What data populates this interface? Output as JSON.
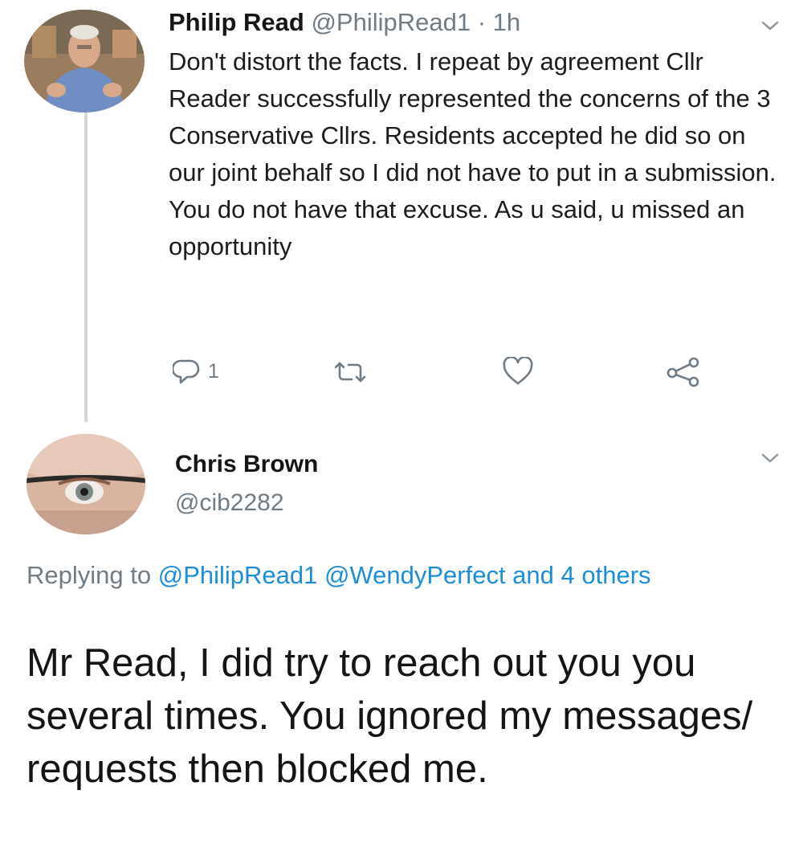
{
  "tweet1": {
    "author_name": "Philip Read",
    "author_handle": "@PhilipRead1",
    "time": "· 1h",
    "text": "Don't distort the facts. I repeat by agreement Cllr Reader successfully represented the concerns of the 3 Conservative Cllrs. Residents accepted he did so on our joint behalf so I did not have to put in a submission. You do not have that excuse. As u said, u missed an opportunity",
    "reply_count": "1",
    "icons": {
      "reply": "reply-icon",
      "retweet": "retweet-icon",
      "like": "heart-icon",
      "share": "share-icon",
      "menu": "chevron-down-icon"
    }
  },
  "tweet2": {
    "author_name": "Chris Brown",
    "author_handle": "@cib2282",
    "replying_prefix": "Replying to",
    "replying_mentions": "@PhilipRead1 @WendyPerfect and 4 others",
    "text": "Mr Read, I did try to reach out you you several times.  You ignored my messages/ requests then blocked me.",
    "icons": {
      "menu": "chevron-down-icon"
    }
  },
  "colors": {
    "background": "#ffffff",
    "text_primary": "#1c1c1c",
    "text_secondary": "#6f7b85",
    "link": "#1d8ed6",
    "thread_line": "#d3d7db"
  }
}
